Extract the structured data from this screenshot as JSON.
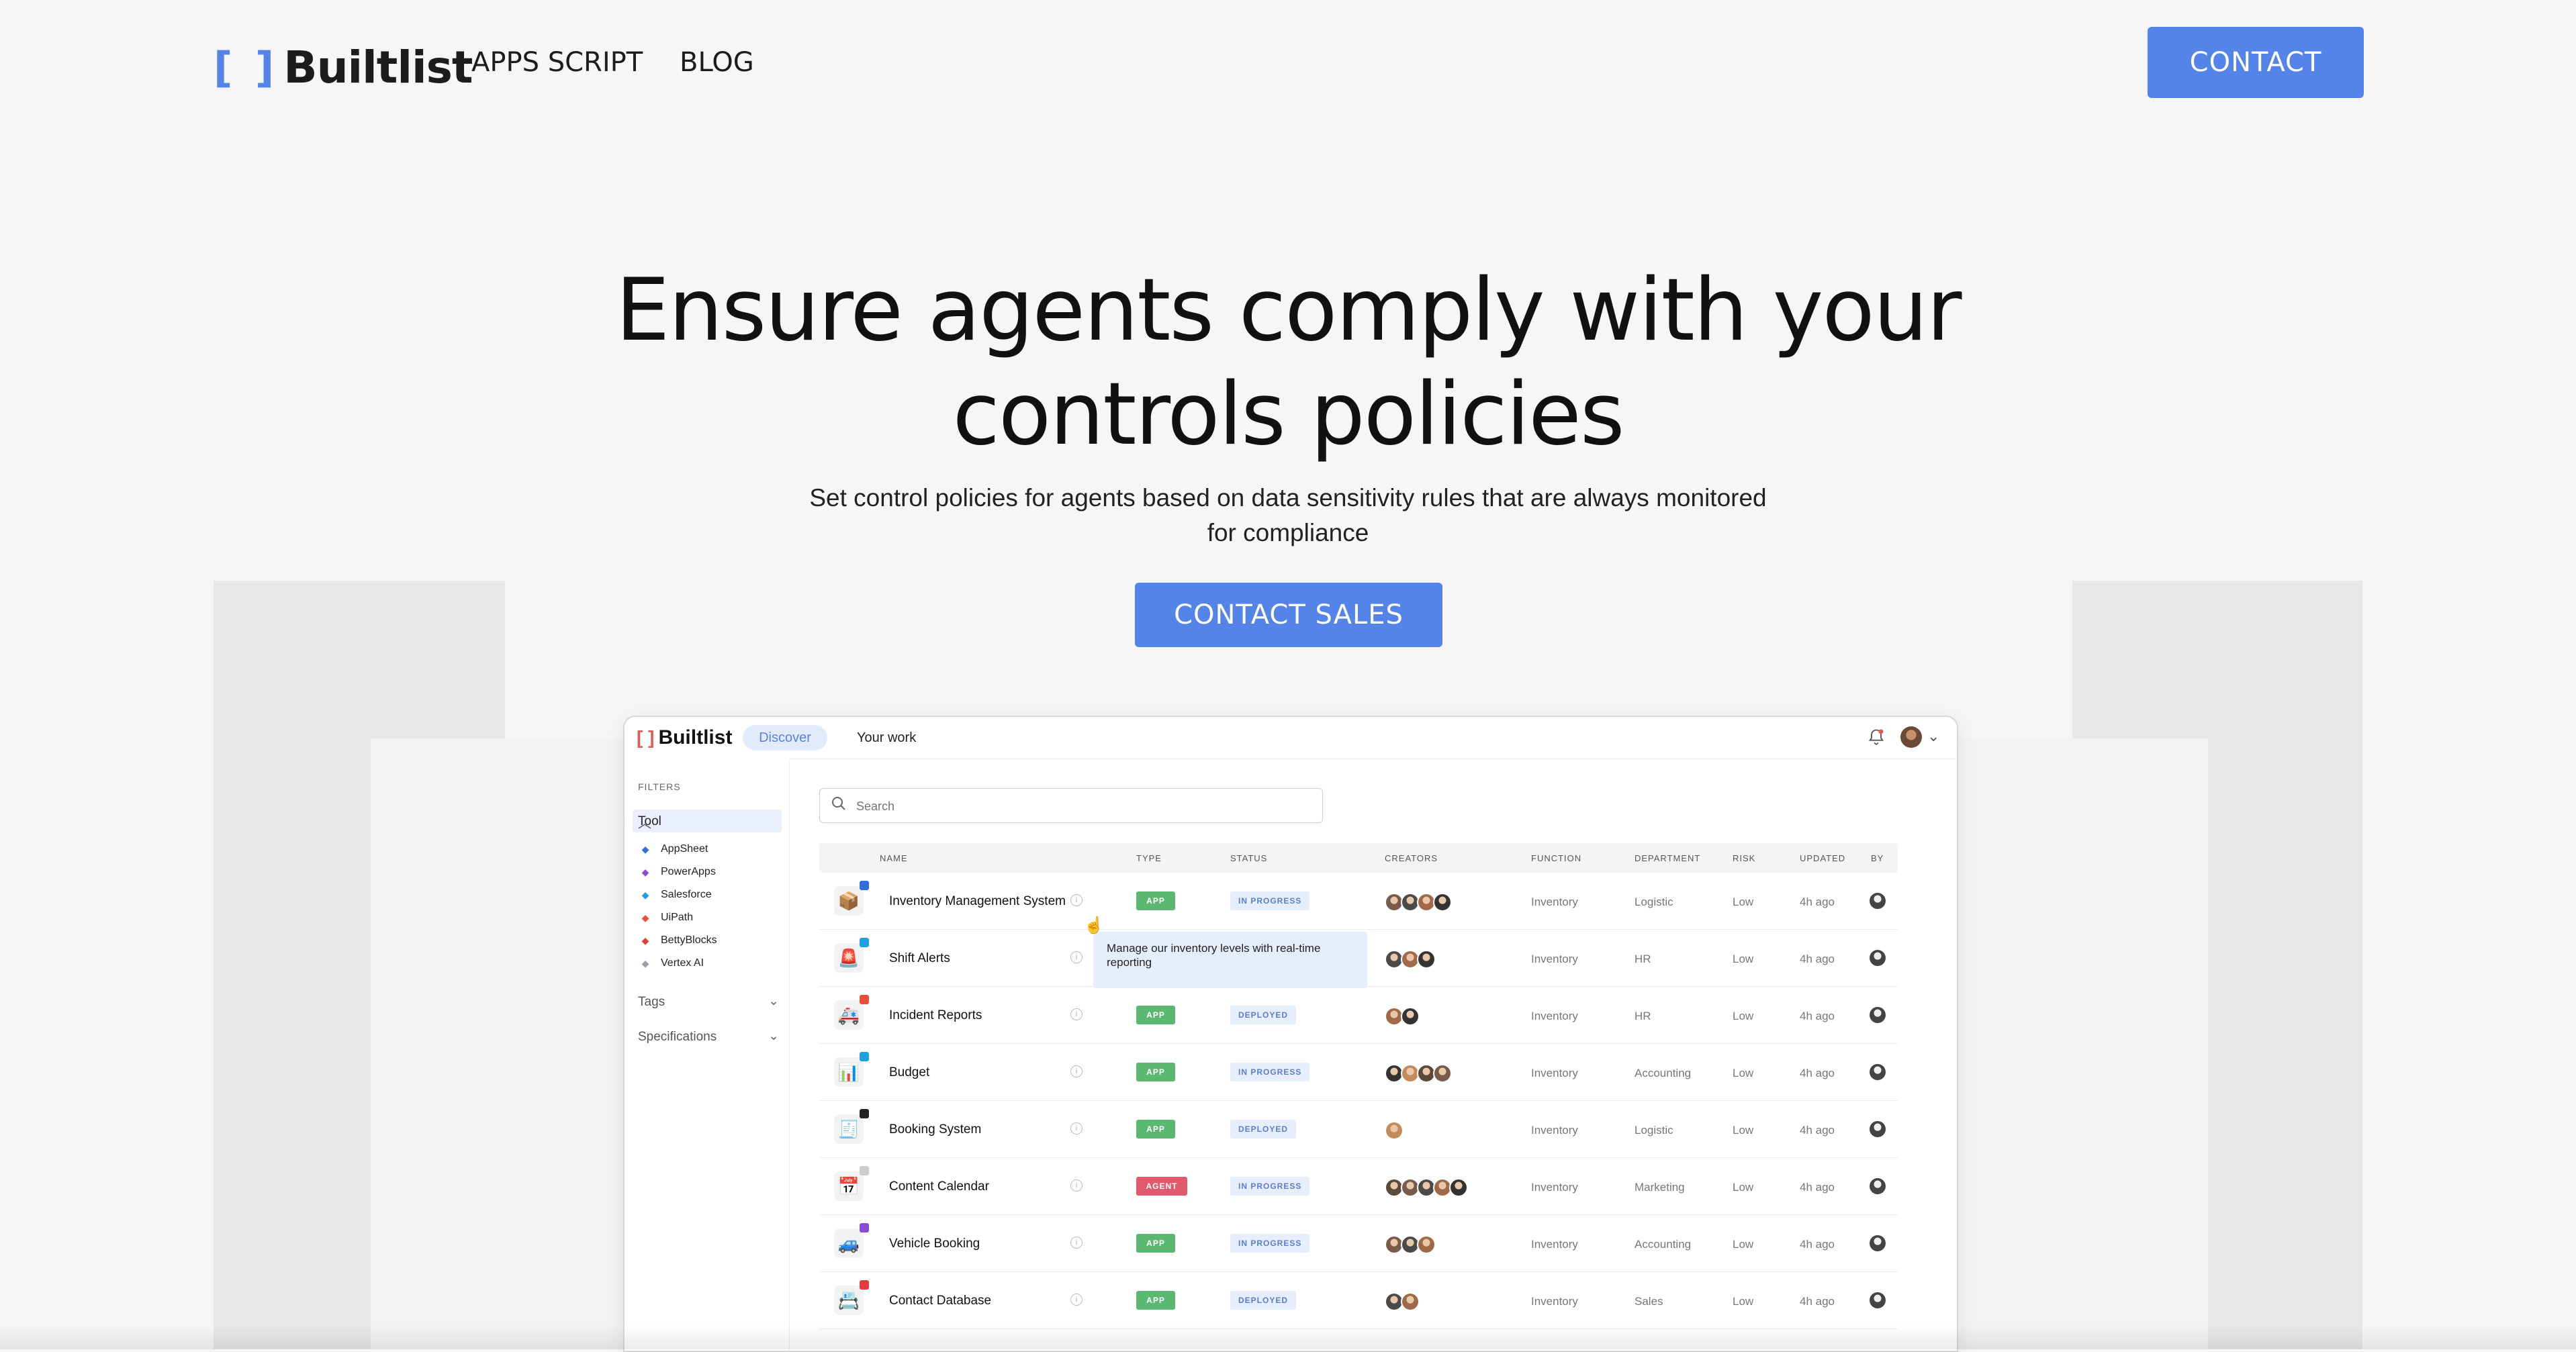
{
  "nav": {
    "logo_bracket": "[ ]",
    "logo_text": "Builtlist",
    "links": [
      "APPS SCRIPT",
      "BLOG"
    ],
    "contact_label": "CONTACT"
  },
  "hero": {
    "title_line1": "Ensure agents comply with your",
    "title_line2": "controls policies",
    "subtitle": "Set control policies for agents based on data sensitivity rules that are always monitored for compliance",
    "cta_label": "CONTACT SALES"
  },
  "app": {
    "logo_bracket": "[ ]",
    "logo_text": "Builtlist",
    "tabs": [
      "Discover",
      "Your work"
    ],
    "filters_heading": "FILTERS",
    "tool_label": "Tool",
    "tools": [
      {
        "label": "AppSheet",
        "icon": "appsheet-icon",
        "color": "#2f6fd8"
      },
      {
        "label": "PowerApps",
        "icon": "powerapps-icon",
        "color": "#8b4ad8"
      },
      {
        "label": "Salesforce",
        "icon": "salesforce-icon",
        "color": "#1ea1e0"
      },
      {
        "label": "UiPath",
        "icon": "uipath-icon",
        "color": "#e8503a"
      },
      {
        "label": "BettyBlocks",
        "icon": "bettyblocks-icon",
        "color": "#e23c3c"
      },
      {
        "label": "Vertex AI",
        "icon": "vertexai-icon",
        "color": "#9aa0a6"
      }
    ],
    "tags_label": "Tags",
    "specs_label": "Specifications",
    "search_placeholder": "Search",
    "columns": [
      "NAME",
      "TYPE",
      "STATUS",
      "CREATORS",
      "FUNCTION",
      "DEPARTMENT",
      "RISK",
      "UPDATED",
      "BY"
    ],
    "tooltip": "Manage our inventory levels with real-time reporting",
    "rows": [
      {
        "name": "Inventory Management System",
        "icon": "📦",
        "type": "APP",
        "status": "IN PROGRESS",
        "creators": 4,
        "function": "Inventory",
        "department": "Logistic",
        "risk": "Low",
        "updated": "4h ago"
      },
      {
        "name": "Shift Alerts",
        "icon": "🚨",
        "type": "",
        "status": "",
        "creators": 3,
        "function": "Inventory",
        "department": "HR",
        "risk": "Low",
        "updated": "4h ago"
      },
      {
        "name": "Incident Reports",
        "icon": "🚑",
        "type": "APP",
        "status": "DEPLOYED",
        "creators": 2,
        "function": "Inventory",
        "department": "HR",
        "risk": "Low",
        "updated": "4h ago"
      },
      {
        "name": "Budget",
        "icon": "📊",
        "type": "APP",
        "status": "IN PROGRESS",
        "creators": 4,
        "function": "Inventory",
        "department": "Accounting",
        "risk": "Low",
        "updated": "4h ago"
      },
      {
        "name": "Booking System",
        "icon": "🧾",
        "type": "APP",
        "status": "DEPLOYED",
        "creators": 1,
        "function": "Inventory",
        "department": "Logistic",
        "risk": "Low",
        "updated": "4h ago"
      },
      {
        "name": "Content Calendar",
        "icon": "📅",
        "type": "AGENT",
        "status": "IN PROGRESS",
        "creators": 5,
        "function": "Inventory",
        "department": "Marketing",
        "risk": "Low",
        "updated": "4h ago"
      },
      {
        "name": "Vehicle Booking",
        "icon": "🚙",
        "type": "APP",
        "status": "IN PROGRESS",
        "creators": 3,
        "function": "Inventory",
        "department": "Accounting",
        "risk": "Low",
        "updated": "4h ago"
      },
      {
        "name": "Contact Database",
        "icon": "📇",
        "type": "APP",
        "status": "DEPLOYED",
        "creators": 2,
        "function": "Inventory",
        "department": "Sales",
        "risk": "Low",
        "updated": "4h ago"
      }
    ]
  },
  "colors": {
    "accent": "#5584e8",
    "app_badge": "#5bb870",
    "agent_badge": "#df5a6c"
  }
}
